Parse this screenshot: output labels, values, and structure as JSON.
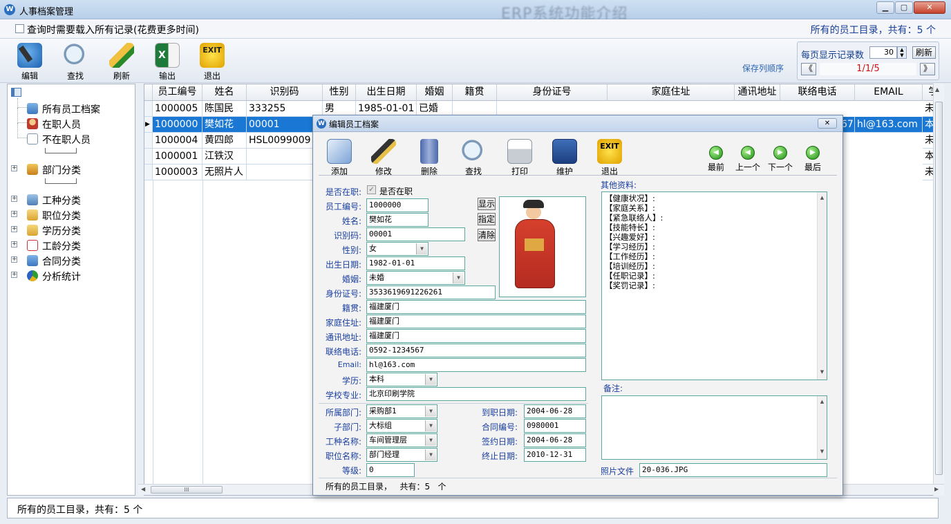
{
  "window": {
    "title": "人事档案管理",
    "bg_text": "ERP系统功能介绍",
    "controls": {
      "min": "▁",
      "max": "▢",
      "close": "✕"
    }
  },
  "infobar": {
    "checkbox_label": "查询时需要载入所有记录(花费更多时间)",
    "count_text": "所有的员工目录，共有：5  个"
  },
  "toolbar": {
    "buttons": [
      "编辑",
      "查找",
      "刷新",
      "输出",
      "退出"
    ],
    "save_order": "保存列顺序"
  },
  "pager": {
    "label": "每页显示记录数",
    "per_page": "30",
    "refresh": "刷新",
    "prev": "《",
    "next": "》",
    "page_text": "1/1/5"
  },
  "tree": {
    "items": [
      "所有员工档案",
      "在职人员",
      "不在职人员",
      "部门分类",
      "工种分类",
      "职位分类",
      "学历分类",
      "工龄分类",
      "合同分类",
      "分析统计"
    ]
  },
  "grid": {
    "columns": [
      "员工编号",
      "姓名",
      "识别码",
      "性别",
      "出生日期",
      "婚姻",
      "籍贯",
      "身份证号",
      "家庭住址",
      "通讯地址",
      "联络电话",
      "EMAIL",
      "学"
    ],
    "rows": [
      {
        "id": "1000005",
        "name": "陈国民",
        "code": "333255",
        "sex": "男",
        "birth": "1985-01-01",
        "marry": "已婚",
        "tail": "",
        "last": "未"
      },
      {
        "id": "1000000",
        "name": "樊如花",
        "code": "00001",
        "sex": "",
        "birth": "",
        "marry": "",
        "tail": "67",
        "email": "hl@163.com",
        "last": "本"
      },
      {
        "id": "1000004",
        "name": "黄四郎",
        "code": "HSL0099009",
        "sex": "",
        "birth": "",
        "marry": "",
        "tail": "",
        "last": "未"
      },
      {
        "id": "1000001",
        "name": "江铁汉",
        "code": "",
        "sex": "",
        "birth": "",
        "marry": "",
        "tail": "",
        "last": "本"
      },
      {
        "id": "1000003",
        "name": "无照片人",
        "code": "",
        "sex": "",
        "birth": "",
        "marry": "",
        "tail": "",
        "last": "未"
      }
    ],
    "hscroll_grip": "III"
  },
  "status": {
    "text": "所有的员工目录，共有：5  个"
  },
  "dialog": {
    "title": "编辑员工档案",
    "buttons": [
      "添加",
      "修改",
      "删除",
      "查找",
      "打印",
      "维护",
      "退出"
    ],
    "nav": [
      "最前",
      "上一个",
      "下一个",
      "最后"
    ],
    "fields": {
      "employed_label": "是否在职:",
      "employed_text": "是否在职",
      "id_label": "员工编号:",
      "id": "1000000",
      "name_label": "姓名:",
      "name": "樊如花",
      "code_label": "识别码:",
      "code": "00001",
      "sex_label": "性别:",
      "sex": "女",
      "birth_label": "出生日期:",
      "birth": "1982-01-01",
      "marry_label": "婚姻:",
      "marry": "未婚",
      "idcard_label": "身份证号:",
      "idcard": "3533619691226261",
      "native_label": "籍贯:",
      "native": "福建厦门",
      "home_label": "家庭住址:",
      "home": "福建厦门",
      "addr_label": "通讯地址:",
      "addr": "福建厦门",
      "phone_label": "联络电话:",
      "phone": "0592-1234567",
      "email_label": "Email:",
      "email": "hl@163.com",
      "edu_label": "学历:",
      "edu": "本科",
      "school_label": "学校专业:",
      "school": "北京印刷学院",
      "dept_label": "所属部门:",
      "dept": "采购部1",
      "subdept_label": "子部门:",
      "subdept": "大标组",
      "job_label": "工种名称:",
      "job": "车间管理层",
      "pos_label": "职位名称:",
      "pos": "部门经理",
      "level_label": "等级:",
      "level": "0",
      "hire_label": "到职日期:",
      "hire": "2004-06-28",
      "contract_label": "合同编号:",
      "contract": "0980001",
      "sign_label": "签约日期:",
      "sign": "2004-06-28",
      "end_label": "终止日期:",
      "end": "2010-12-31"
    },
    "photo_buttons": [
      "显示",
      "指定",
      "清除"
    ],
    "other_label": "其他资料:",
    "other_lines": [
      "【健康状况】:",
      "【家庭关系】:",
      "【紧急联络人】:",
      "【技能特长】:",
      "【兴趣爱好】:",
      "【学习经历】:",
      "【工作经历】:",
      "【培训经历】:",
      "【任职记录】:",
      "【奖罚记录】:"
    ],
    "remark_label": "备注:",
    "photo_file_label": "照片文件",
    "photo_file": "20-036.JPG",
    "footer": "所有的员工目录，   共有：5   个"
  }
}
